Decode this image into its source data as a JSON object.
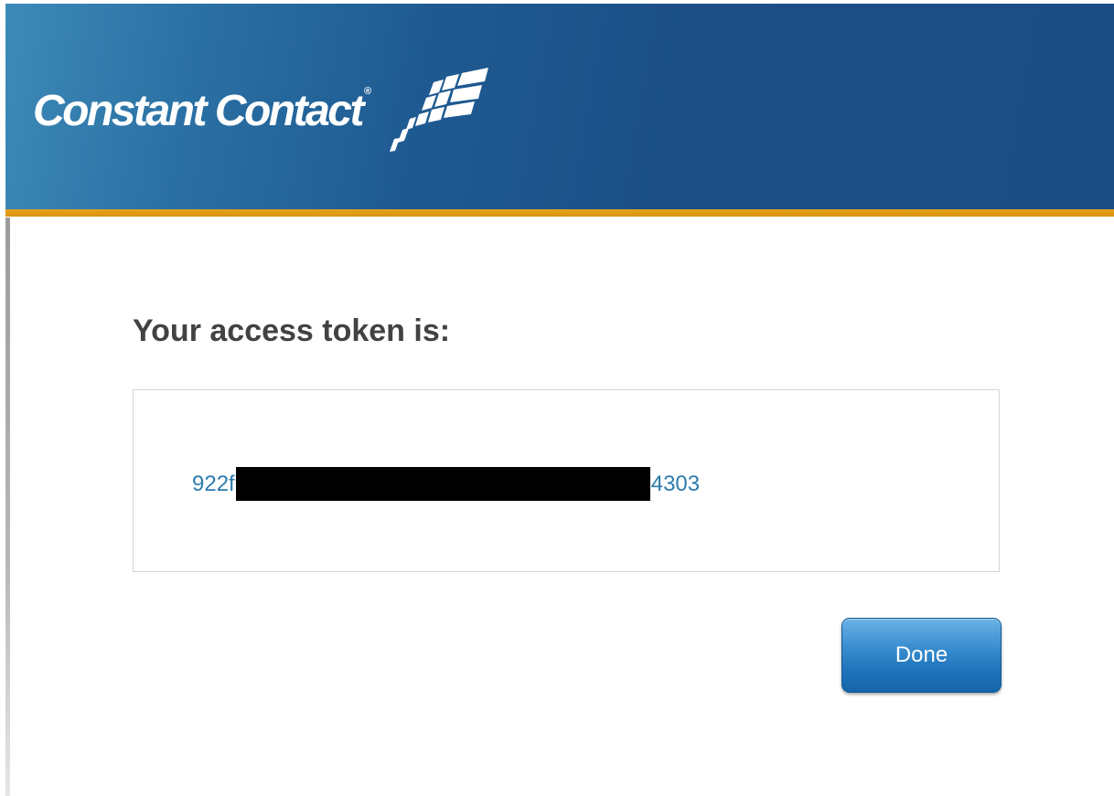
{
  "header": {
    "logo_text": "Constant Contact",
    "logo_registered": "®",
    "logo_mark_icon": "constant-contact-flag-icon",
    "colors": {
      "banner_dark": "#1b4d84",
      "banner_light": "#3d8ab8",
      "accent_gold": "#e6a21a"
    }
  },
  "main": {
    "heading": "Your access token is:",
    "token_prefix": "922f",
    "token_suffix": "4303",
    "token_color": "#2c7bad"
  },
  "actions": {
    "done_label": "Done",
    "done_color": "#1f74bb"
  }
}
